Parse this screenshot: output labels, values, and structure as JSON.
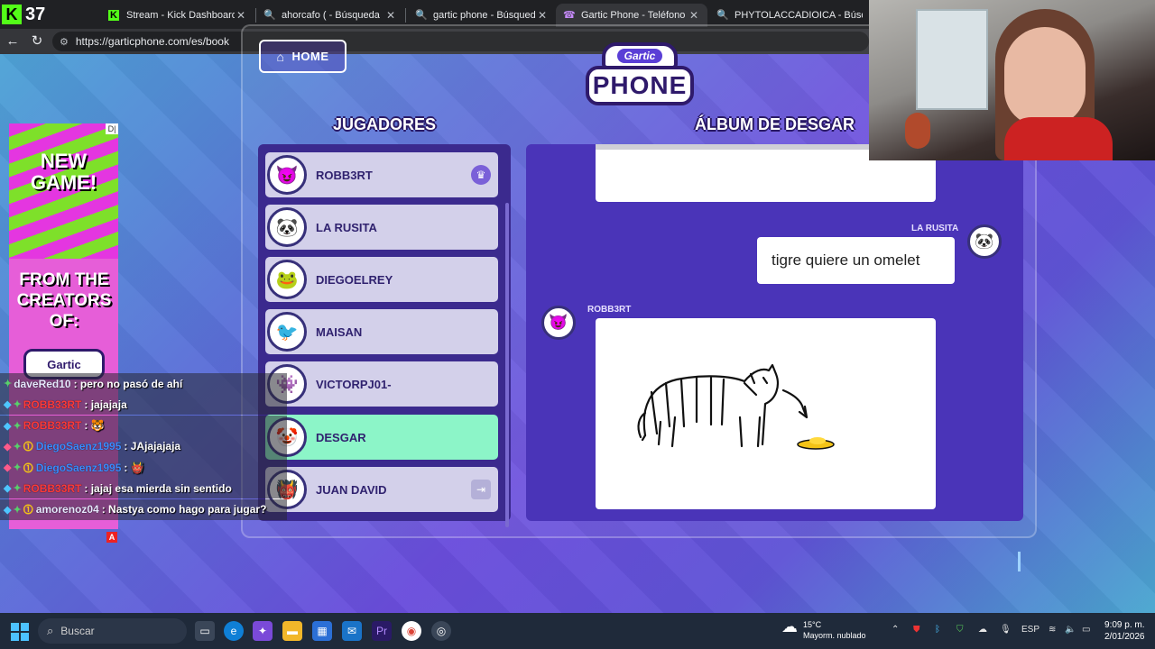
{
  "browser": {
    "stream_count": "37",
    "tabs": [
      {
        "title": "Stream - Kick Dashboard",
        "favicon": "K"
      },
      {
        "title": "ahorcafo ( - Búsqueda",
        "favicon": "🔍"
      },
      {
        "title": "gartic phone - Búsqueda",
        "favicon": "🔍"
      },
      {
        "title": "Gartic Phone - Teléfono Descon",
        "favicon": "☎"
      },
      {
        "title": "PHYTOLACCADIOICA - Búsque",
        "favicon": "🔍"
      }
    ],
    "url": "https://garticphone.com/es/book"
  },
  "page": {
    "home_label": "HOME",
    "logo_top": "Gartic",
    "logo_bottom": "PHONE",
    "players_title": "JUGADORES",
    "album_title": "ÁLBUM DE DESGAR"
  },
  "players": [
    {
      "name": "ROBB3RT",
      "avatar": "😈",
      "badge": "♛"
    },
    {
      "name": "LA RUSITA",
      "avatar": "🐼",
      "badge": ""
    },
    {
      "name": "DIEGOELREY",
      "avatar": "🐸",
      "badge": ""
    },
    {
      "name": "MAISAN",
      "avatar": "🐦",
      "badge": ""
    },
    {
      "name": "VICTORPJ01-",
      "avatar": "👾",
      "badge": ""
    },
    {
      "name": "DESGAR",
      "avatar": "🤡",
      "badge": ""
    },
    {
      "name": "JUAN DAVID",
      "avatar": "👹",
      "badge": "⇥"
    }
  ],
  "album": {
    "msg1_author": "LA RUSITA",
    "msg1_text": "tigre quiere un omelet",
    "msg2_author": "ROBB3RT",
    "avatar1": "🐼",
    "avatar2": "😈"
  },
  "ad": {
    "new_game": "NEW GAME!",
    "from": "FROM THE CREATORS OF:",
    "logo": "Gartic",
    "corner": "D|",
    "marker": "A"
  },
  "chat": [
    {
      "user": "daveRed10",
      "color": "#e8e8ff",
      "msg": ": pero no pasó de ahí"
    },
    {
      "user": "ROBB33RT",
      "color": "#ff3b3b",
      "msg": ": jajajaja"
    },
    {
      "user": "ROBB33RT",
      "color": "#ff3b3b",
      "msg": ": 🐯"
    },
    {
      "user": "DiegoSaenz1995",
      "color": "#3b8cff",
      "msg": ": JAjajajaja"
    },
    {
      "user": "DiegoSaenz1995",
      "color": "#3b8cff",
      "msg": ": 👹"
    },
    {
      "user": "ROBB33RT",
      "color": "#ff3b3b",
      "msg": ": jajaj esa mierda sin sentido"
    },
    {
      "user": "amorenoz04",
      "color": "#e8e8ff",
      "msg": ": Nastya como hago para jugar?"
    }
  ],
  "taskbar": {
    "search_placeholder": "Buscar",
    "weather_temp": "15°C",
    "weather_desc": "Mayorm. nublado",
    "lang": "ESP",
    "time": "9:09 p. m.",
    "date": "2/01/2026"
  }
}
